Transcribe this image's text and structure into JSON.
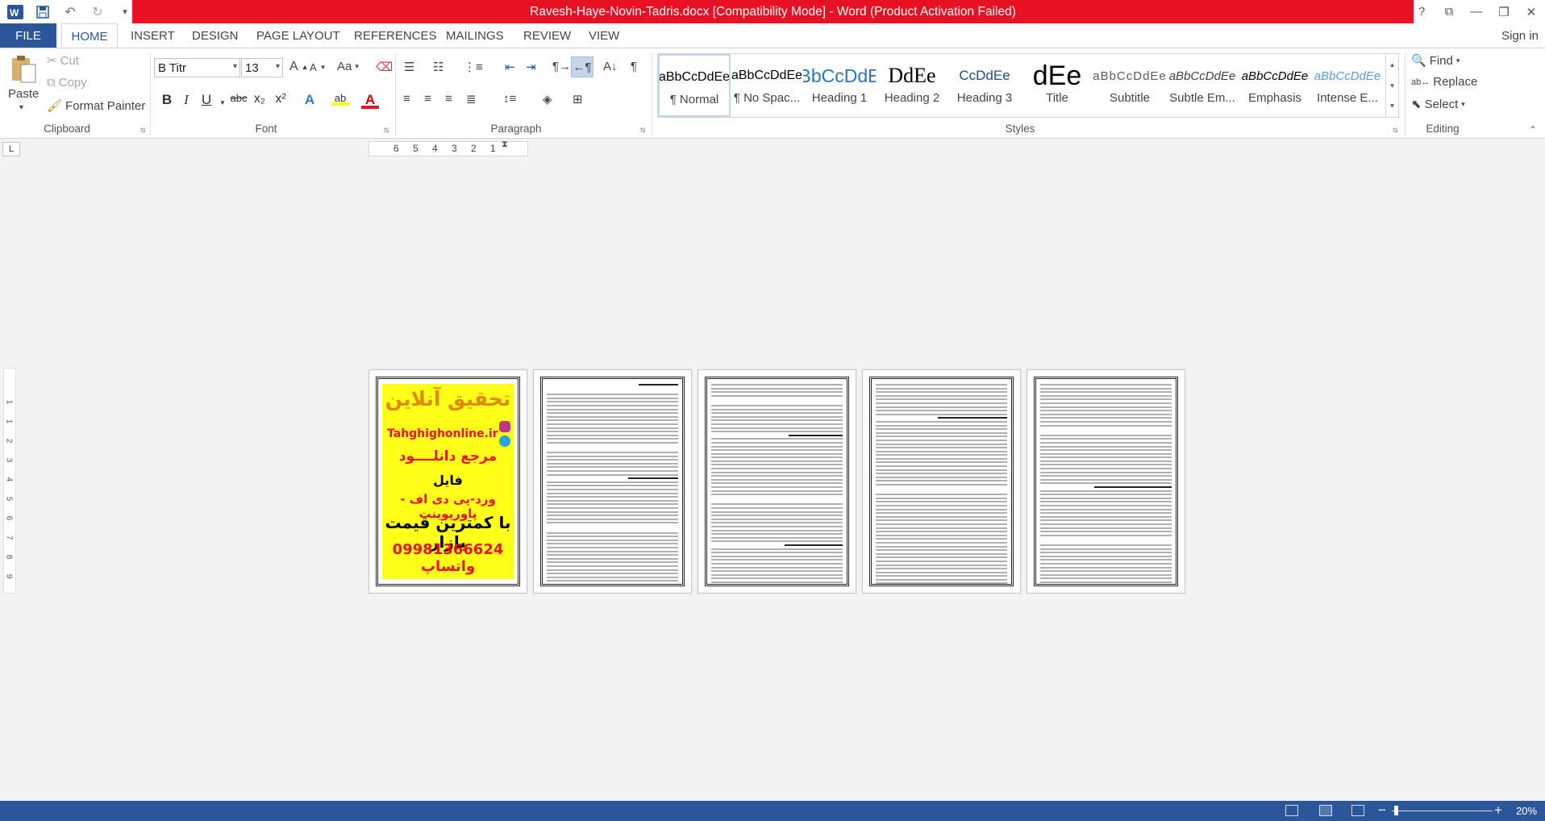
{
  "window": {
    "title": "Ravesh-Haye-Novin-Tadris.docx [Compatibility Mode] -  Word (Product Activation Failed)",
    "controls": [
      "?",
      "⧉",
      "—",
      "❐",
      "✕"
    ]
  },
  "tabs": {
    "file": "FILE",
    "items": [
      "HOME",
      "INSERT",
      "DESIGN",
      "PAGE LAYOUT",
      "REFERENCES",
      "MAILINGS",
      "REVIEW",
      "VIEW"
    ],
    "active": "HOME",
    "sign_in": "Sign in"
  },
  "clipboard": {
    "paste": "Paste",
    "cut": "Cut",
    "copy": "Copy",
    "format_painter": "Format Painter",
    "label": "Clipboard"
  },
  "font": {
    "name": "B Titr",
    "size": "13",
    "grow": "A",
    "shrink": "A",
    "change_case": "Aa",
    "bold": "B",
    "italic": "I",
    "underline": "U",
    "strike": "abc",
    "subscript": "x₂",
    "superscript": "x²",
    "label": "Font"
  },
  "paragraph": {
    "label": "Paragraph",
    "pilcrow": "¶"
  },
  "styles": {
    "label": "Styles",
    "items": [
      {
        "preview": "aBbCcDdEe",
        "name": "¶ Normal"
      },
      {
        "preview": "aBbCcDdEe",
        "name": "¶ No Spac..."
      },
      {
        "preview": "aBbCcDdEe",
        "name": "Heading 1"
      },
      {
        "preview": "DdEe",
        "name": "Heading 2"
      },
      {
        "preview": "CcDdEe",
        "name": "Heading 3"
      },
      {
        "preview": "dEe",
        "name": "Title"
      },
      {
        "preview": "aBbCcDdEe",
        "name": "Subtitle"
      },
      {
        "preview": "aBbCcDdEe",
        "name": "Subtle Em..."
      },
      {
        "preview": "aBbCcDdEe",
        "name": "Emphasis"
      },
      {
        "preview": "aBbCcDdEe",
        "name": "Intense E..."
      }
    ]
  },
  "editing": {
    "find": "Find",
    "replace": "Replace",
    "select": "Select",
    "label": "Editing"
  },
  "ruler": {
    "tab_selector": "L",
    "numbers": [
      "6",
      "5",
      "4",
      "3",
      "2",
      "1"
    ],
    "vertical_numbers": [
      "1",
      "1",
      "2",
      "3",
      "4",
      "5",
      "6",
      "7",
      "8",
      "9"
    ]
  },
  "ad_page": {
    "line1": "تحقیق آنلاین",
    "line2": "Tahghighonline.ir",
    "line3": "مرجع دانلــــود",
    "line4": "فایل",
    "line5": "ورد-پی دی اف - پاورپوینت",
    "line6": "با کمترین قیمت بازار",
    "line7": "09981366624 واتساپ"
  },
  "statusbar": {
    "zoom": "20%",
    "zoom_level": 0.2
  },
  "colors": {
    "brand": "#2b579a",
    "title_bar": "#e81123",
    "ad_background": "#ffff1a"
  }
}
